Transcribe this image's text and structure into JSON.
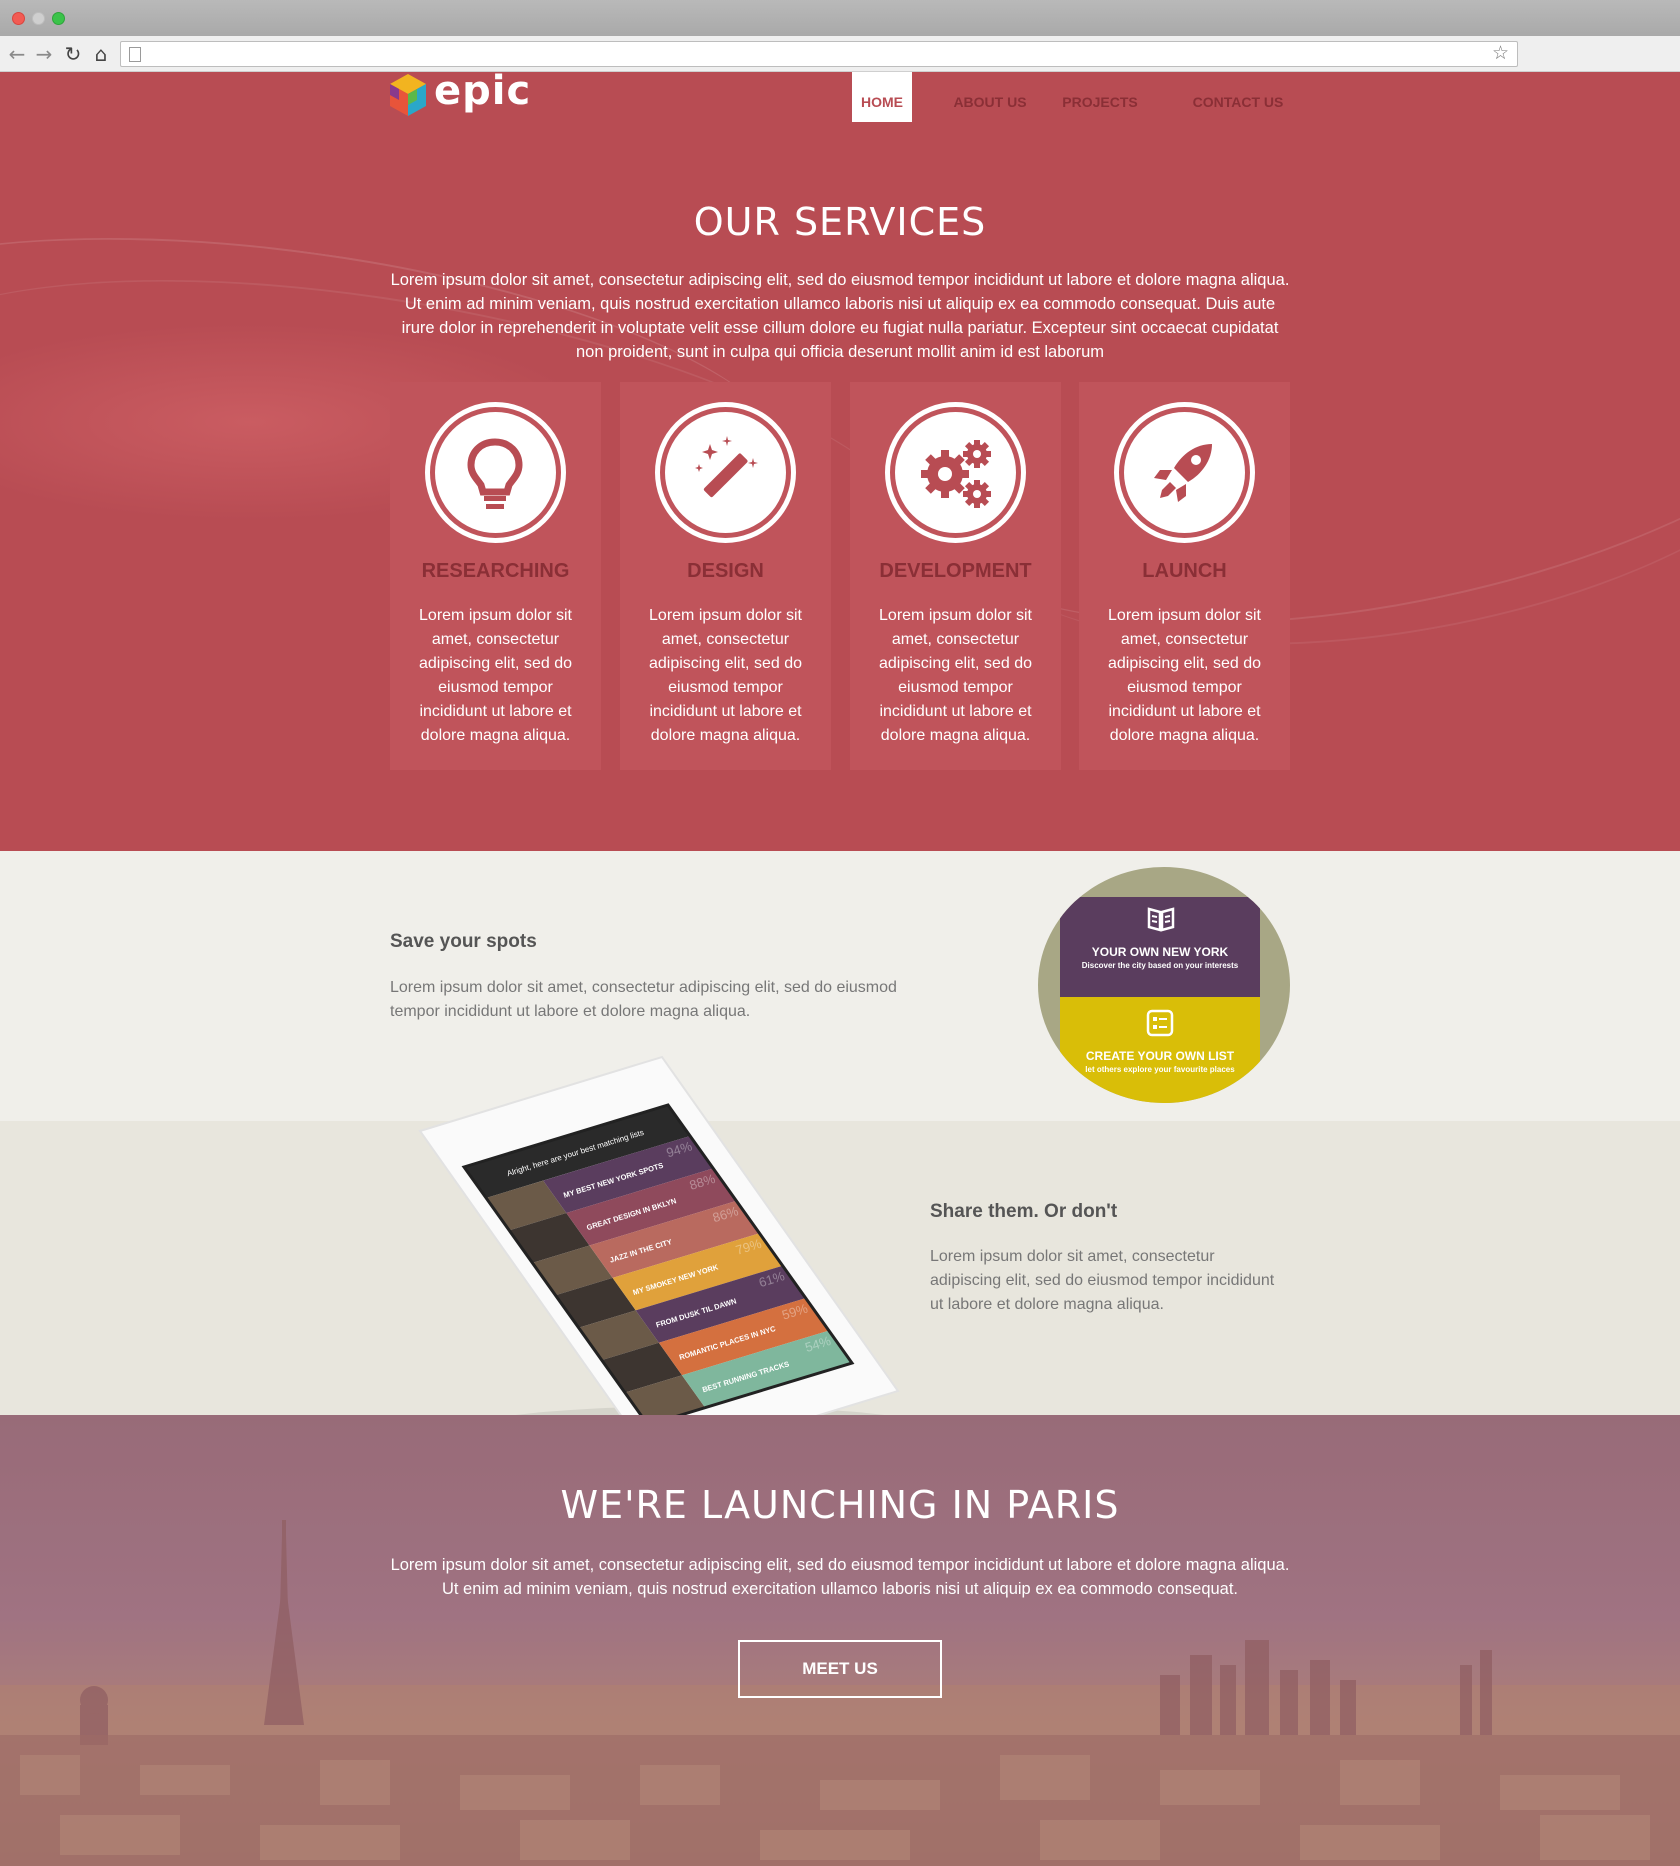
{
  "browser": {
    "back_icon": "back-arrow-icon",
    "forward_icon": "forward-arrow-icon",
    "reload_icon": "reload-icon",
    "home_icon": "home-icon",
    "address_value": "",
    "bookmark_icon": "star-icon"
  },
  "brand": {
    "logo_text": "epic"
  },
  "nav": {
    "items": [
      {
        "label": "HOME",
        "active": true
      },
      {
        "label": "ABOUT US",
        "active": false
      },
      {
        "label": "PROJECTS",
        "active": false
      },
      {
        "label": "CONTACT US",
        "active": false
      }
    ]
  },
  "services": {
    "title": "OUR SERVICES",
    "lead": "Lorem ipsum dolor sit amet, consectetur adipiscing elit, sed do eiusmod tempor incididunt ut labore et dolore magna aliqua. Ut enim ad minim veniam, quis nostrud exercitation ullamco laboris nisi ut aliquip ex ea commodo consequat. Duis aute irure dolor in reprehenderit in voluptate velit esse cillum dolore eu fugiat nulla pariatur. Excepteur sint occaecat cupidatat non proident, sunt in culpa qui officia deserunt mollit anim id est laborum",
    "cards": [
      {
        "icon": "lightbulb-icon",
        "title": "RESEARCHING",
        "text": "Lorem ipsum dolor sit amet, consectetur adipiscing elit, sed do eiusmod tempor incididunt ut labore et dolore magna aliqua."
      },
      {
        "icon": "magic-wand-icon",
        "title": "DESIGN",
        "text": "Lorem ipsum dolor sit amet, consectetur adipiscing elit, sed do eiusmod tempor incididunt ut labore et dolore magna aliqua."
      },
      {
        "icon": "gears-icon",
        "title": "DEVELOPMENT",
        "text": "Lorem ipsum dolor sit amet, consectetur adipiscing elit, sed do eiusmod tempor incididunt ut labore et dolore magna aliqua."
      },
      {
        "icon": "rocket-icon",
        "title": "LAUNCH",
        "text": "Lorem ipsum dolor sit amet, consectetur adipiscing elit, sed do eiusmod tempor incididunt ut labore et dolore magna aliqua."
      }
    ]
  },
  "spots": {
    "title": "Save your spots",
    "text": "Lorem ipsum dolor sit amet, consectetur adipiscing elit, sed do eiusmod tempor incididunt ut labore et dolore magna aliqua.",
    "app": {
      "top_title": "YOUR OWN NEW YORK",
      "top_sub": "Discover the city based on your interests",
      "bottom_title": "CREATE YOUR OWN LIST",
      "bottom_sub": "let others explore your favourite places"
    }
  },
  "share": {
    "title": "Share them. Or don't",
    "text": "Lorem ipsum dolor sit amet, consectetur adipiscing elit, sed do eiusmod tempor incididunt ut labore et dolore magna aliqua.",
    "phone": {
      "header": "Alright, here are your best matching lists",
      "rows": [
        {
          "title": "MY BEST NEW YORK SPOTS",
          "pct": "94%",
          "color": "#5a3d5e"
        },
        {
          "title": "GREAT DESIGN IN BKLYN",
          "pct": "88%",
          "color": "#8f4a5c"
        },
        {
          "title": "JAZZ IN THE CITY",
          "pct": "86%",
          "color": "#b96a5f"
        },
        {
          "title": "MY SMOKEY NEW YORK",
          "pct": "79%",
          "color": "#e0a13b"
        },
        {
          "title": "FROM DUSK TIL DAWN",
          "pct": "61%",
          "color": "#5a3d5e"
        },
        {
          "title": "ROMANTIC PLACES IN NYC",
          "pct": "59%",
          "color": "#d4703f"
        },
        {
          "title": "BEST RUNNING TRACKS",
          "pct": "54%",
          "color": "#7fb79d"
        }
      ]
    }
  },
  "paris": {
    "title": "WE'RE LAUNCHING IN PARIS",
    "text": "Lorem ipsum dolor sit amet, consectetur adipiscing elit, sed do eiusmod tempor incididunt ut labore et dolore magna aliqua. Ut enim ad minim veniam, quis nostrud exercitation ullamco laboris nisi ut aliquip ex ea commodo consequat.",
    "button": "MEET US"
  },
  "colors": {
    "services_bg": "#b84c53",
    "card_bg": "#c0545b",
    "card_title": "#8a2f36",
    "spots_bg": "#f0efea",
    "share_bg": "#e8e6dd",
    "paris_overlay": "#a07884"
  }
}
